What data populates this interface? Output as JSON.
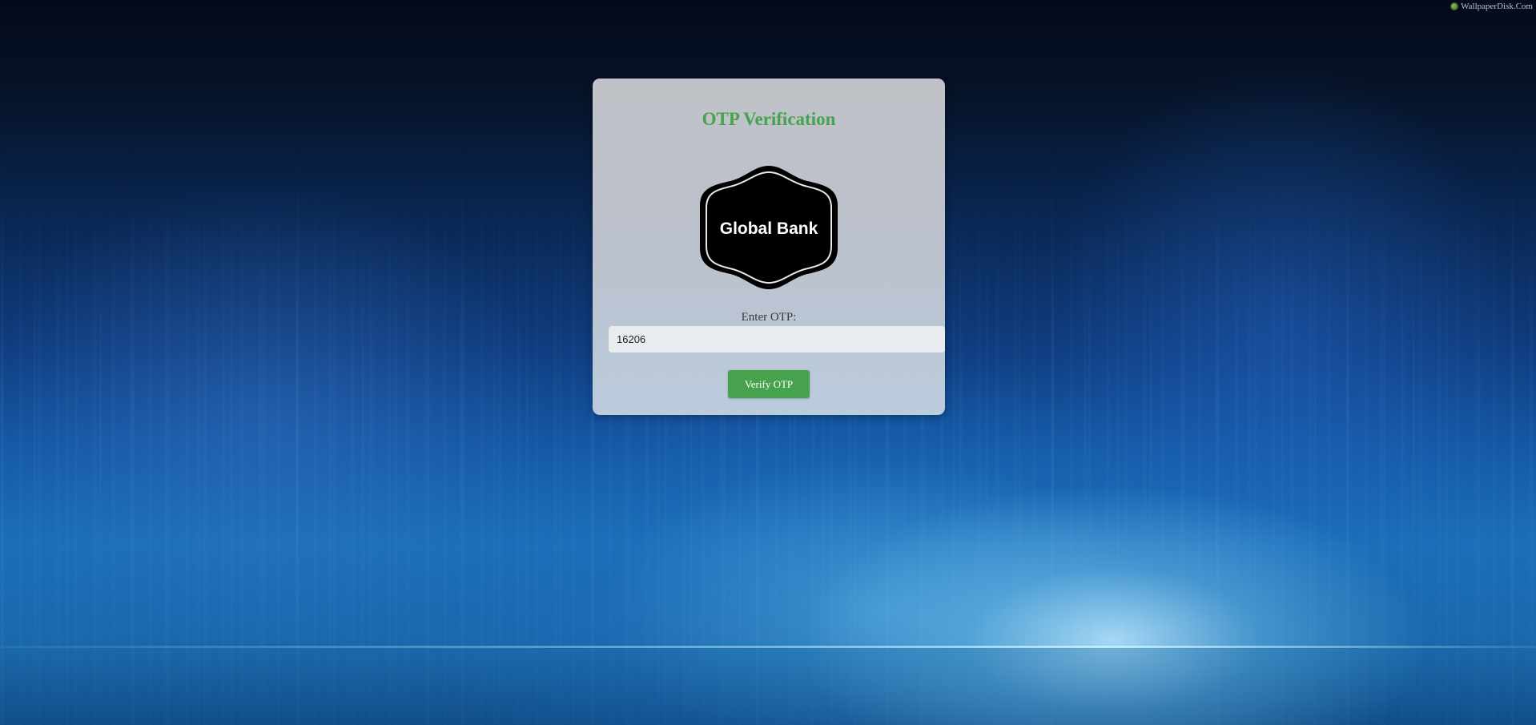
{
  "watermark": {
    "text": "WallpaperDisk.Com",
    "icon": "wallpaperdisk-logo-icon"
  },
  "card": {
    "title": "OTP Verification",
    "logo": {
      "text": "Global Bank",
      "icon": "global-bank-badge-logo"
    },
    "otp_label": "Enter OTP:",
    "otp_value": "16206",
    "verify_button_label": "Verify OTP"
  },
  "colors": {
    "accent_green": "#46a24d",
    "card_background": "#c6c8cd",
    "input_background": "#e9ecef",
    "logo_fill": "#000000"
  }
}
